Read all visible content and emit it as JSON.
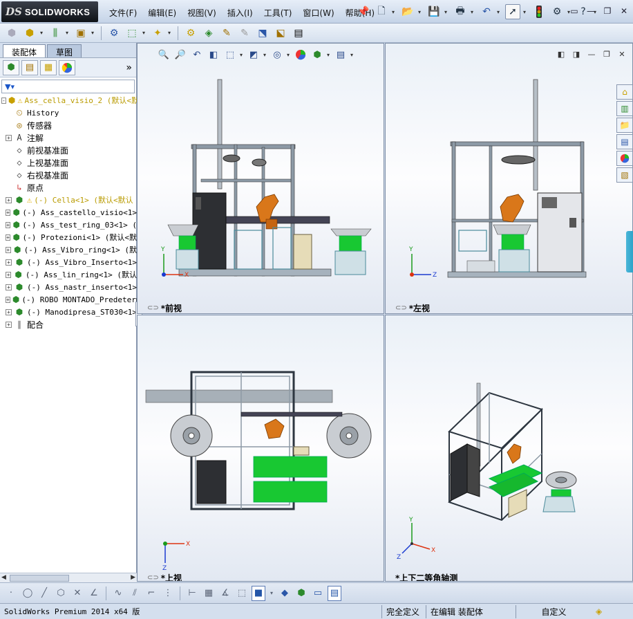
{
  "title_bar": {
    "logo_ds": "DS",
    "logo_text": "SOLIDWORKS",
    "menu": [
      "文件(F)",
      "编辑(E)",
      "视图(V)",
      "插入(I)",
      "工具(T)",
      "窗口(W)",
      "帮助(H)"
    ]
  },
  "left_panel": {
    "tabs": [
      "装配体",
      "草图"
    ],
    "active_tab": "装配体",
    "more_symbol": "»",
    "tree": [
      {
        "label": "Ass_cella_visio_2  (默认<默",
        "icon": "assembly-icon",
        "warning": true,
        "expander": "-",
        "root": true,
        "color": "yellow"
      },
      {
        "label": "History",
        "icon": "history-icon"
      },
      {
        "label": "传感器",
        "icon": "sensor-icon"
      },
      {
        "label": "注解",
        "icon": "annotation-icon",
        "expander": "+"
      },
      {
        "label": "前视基准面",
        "icon": "plane-icon"
      },
      {
        "label": "上视基准面",
        "icon": "plane-icon"
      },
      {
        "label": "右视基准面",
        "icon": "plane-icon"
      },
      {
        "label": "原点",
        "icon": "origin-icon"
      },
      {
        "label": "(-) Cella<1> (默认<默认",
        "icon": "component-icon",
        "warning": true,
        "expander": "+",
        "color": "yellow"
      },
      {
        "label": "(-) Ass_castello_visio<1>",
        "icon": "component-icon",
        "expander": "+"
      },
      {
        "label": "(-) Ass_test_ring_03<1> (",
        "icon": "component-icon",
        "expander": "+"
      },
      {
        "label": "(-) Protezioni<1> (默认<默",
        "icon": "component-icon",
        "expander": "+"
      },
      {
        "label": "(-) Ass_Vibro_ring<1> (默",
        "icon": "component-icon",
        "expander": "+"
      },
      {
        "label": "(-) Ass_Vibro_Inserto<1>",
        "icon": "component-icon",
        "expander": "+"
      },
      {
        "label": "(-) Ass_lin_ring<1> (默认",
        "icon": "component-icon",
        "expander": "+"
      },
      {
        "label": "(-) Ass_nastr_inserto<1>",
        "icon": "component-icon",
        "expander": "+"
      },
      {
        "label": "(-) ROBO MONTADO_Predeterm",
        "icon": "component-icon",
        "expander": "+"
      },
      {
        "label": "(-) Manodipresa_ST030<1>",
        "icon": "component-icon",
        "expander": "+"
      },
      {
        "label": "配合",
        "icon": "mates-icon",
        "expander": "+"
      }
    ]
  },
  "viewports": {
    "front": "*前视",
    "left": "*左视",
    "top": "*上视",
    "iso": "*上下二等角轴测"
  },
  "axes": {
    "x": "X",
    "y": "Y",
    "z": "Z"
  },
  "status_bar": {
    "product": "SolidWorks Premium 2014 x64 版",
    "state": "完全定义",
    "mode": "在编辑 装配体",
    "custom": "自定义"
  },
  "colors": {
    "frame": "#8d9aa6",
    "frame_dark": "#3d4650",
    "robot": "#d9771a",
    "green": "#18c832",
    "cabinet": "#2d2f33",
    "tan": "#e6dcb8",
    "bowl": "#c9cdd2"
  }
}
